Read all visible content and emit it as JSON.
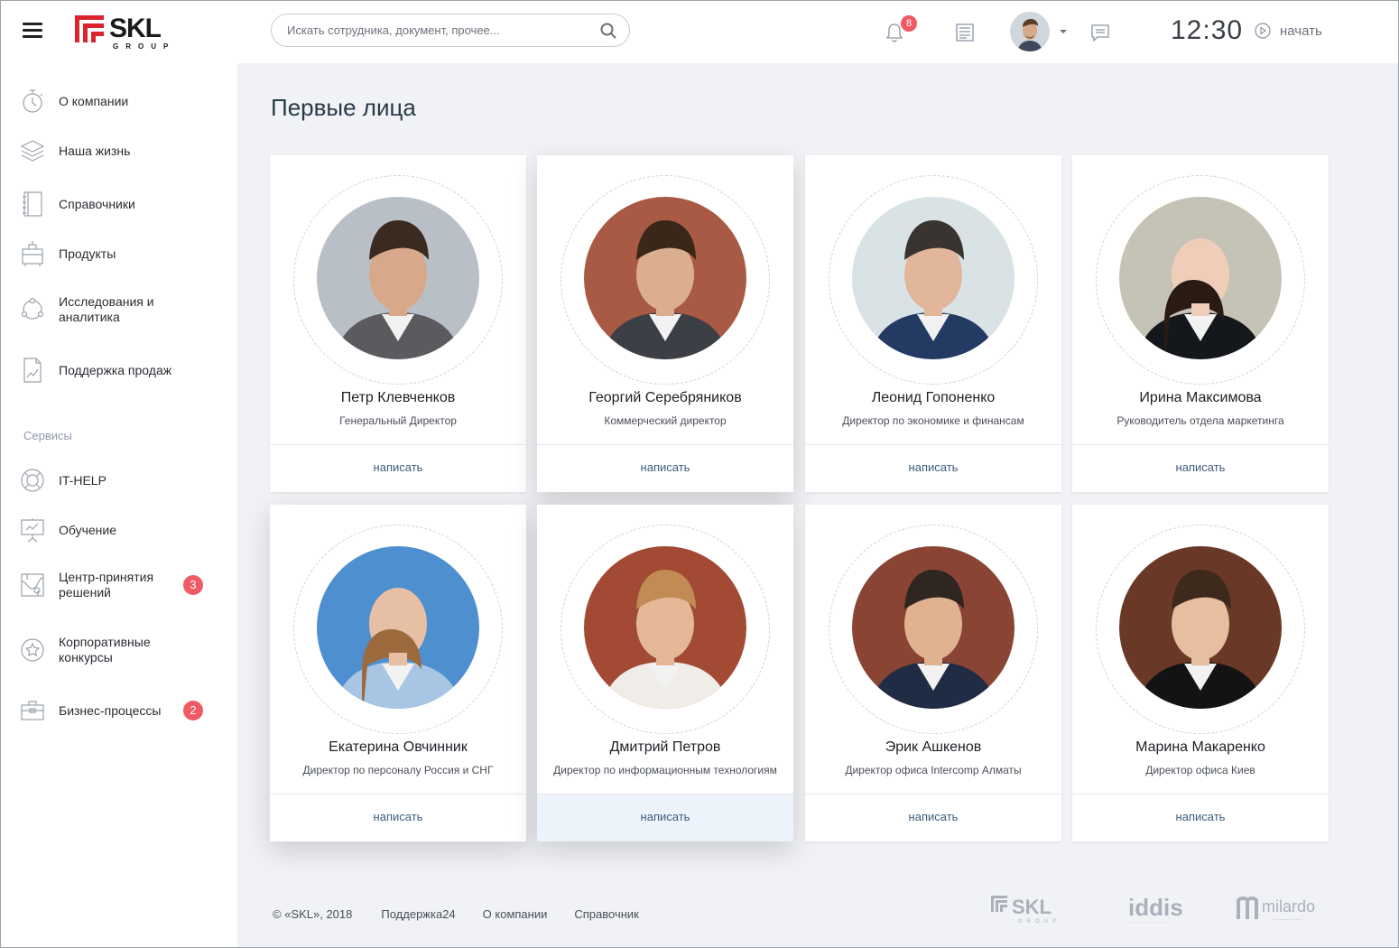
{
  "logo": {
    "word": "SKL",
    "sub": "GROUP"
  },
  "nav": [
    {
      "label": "О компании",
      "icon": "timer-icon"
    },
    {
      "label": "Наша жизнь",
      "icon": "layers-icon"
    },
    {
      "label": "Справочники",
      "icon": "notebook-icon"
    },
    {
      "label": "Продукты",
      "icon": "product-icon"
    },
    {
      "label": "Исследования и аналитика",
      "icon": "cycle-icon"
    },
    {
      "label": "Поддержка продаж",
      "icon": "chart-doc-icon"
    }
  ],
  "services_label": "Сервисы",
  "services": [
    {
      "label": "IT-HELP",
      "icon": "lifebuoy-icon",
      "badge": ""
    },
    {
      "label": "Обучение",
      "icon": "presentation-icon",
      "badge": ""
    },
    {
      "label": "Центр-принятия решений",
      "icon": "map-icon",
      "badge": "3"
    },
    {
      "label": "Корпоративные конкурсы",
      "icon": "star-icon",
      "badge": ""
    },
    {
      "label": "Бизнес-процессы",
      "icon": "briefcase-icon",
      "badge": "2"
    }
  ],
  "search": {
    "placeholder": "Искать сотрудника, документ, прочее..."
  },
  "topbar": {
    "notifications": "8",
    "time": "12:30",
    "start_label": "начать"
  },
  "page_title": "Первые лица",
  "people": [
    {
      "name": "Петр Клевченков",
      "role": "Генеральный Директор",
      "action": "написать"
    },
    {
      "name": "Георгий Серебряников",
      "role": "Коммерческий директор",
      "action": "написать"
    },
    {
      "name": "Леонид Гопоненко",
      "role": "Директор по экономике и финансам",
      "action": "написать"
    },
    {
      "name": "Ирина Максимова",
      "role": "Руководитель отдела маркетинга",
      "action": "написать"
    },
    {
      "name": "Екатерина Овчинник",
      "role": "Директор по персоналу Россия и СНГ",
      "action": "написать"
    },
    {
      "name": "Дмитрий Петров",
      "role": "Директор по информационным технологиям",
      "action": "написать"
    },
    {
      "name": "Эрик Ашкенов",
      "role": "Директор офиса Intercomp Алматы",
      "action": "написать"
    },
    {
      "name": "Марина Макаренко",
      "role": "Директор офиса Киев",
      "action": "написать"
    }
  ],
  "footer": {
    "copyright": "© «SKL», 2018",
    "links": [
      "Поддержка24",
      "О компании",
      "Справочник"
    ],
    "brand_logos": [
      "SKL GROUP",
      "iddis",
      "milardo"
    ]
  },
  "colors": {
    "accent_red": "#d9232d",
    "badge": "#ef5a64",
    "link": "#3d5c80",
    "background": "#f1f2f6"
  }
}
